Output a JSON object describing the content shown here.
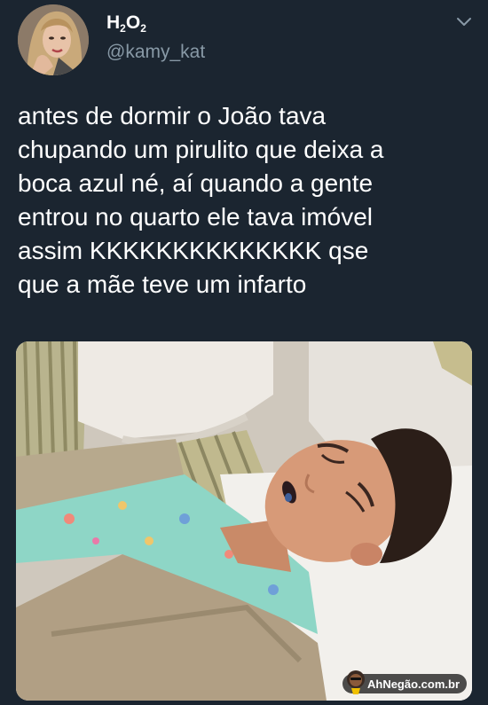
{
  "tweet": {
    "display_name_base": "H",
    "display_name_sub1": "2",
    "display_name_mid": "O",
    "display_name_sub2": "2",
    "handle": "@kamy_kat",
    "text_lines": [
      "antes de dormir o João tava",
      "chupando um pirulito que deixa a",
      "boca azul né, aí quando a gente",
      "entrou no quarto ele tava imóvel",
      "assim KKKKKKKKKKKKKK qse",
      "que a mãe teve um infarto"
    ]
  },
  "watermark": {
    "text": "AhNegão.com.br"
  },
  "icons": {
    "menu": "chevron-down-icon",
    "avatar": "profile-avatar"
  },
  "colors": {
    "background": "#1b2530",
    "handle": "#8899a6",
    "text": "#ffffff"
  }
}
